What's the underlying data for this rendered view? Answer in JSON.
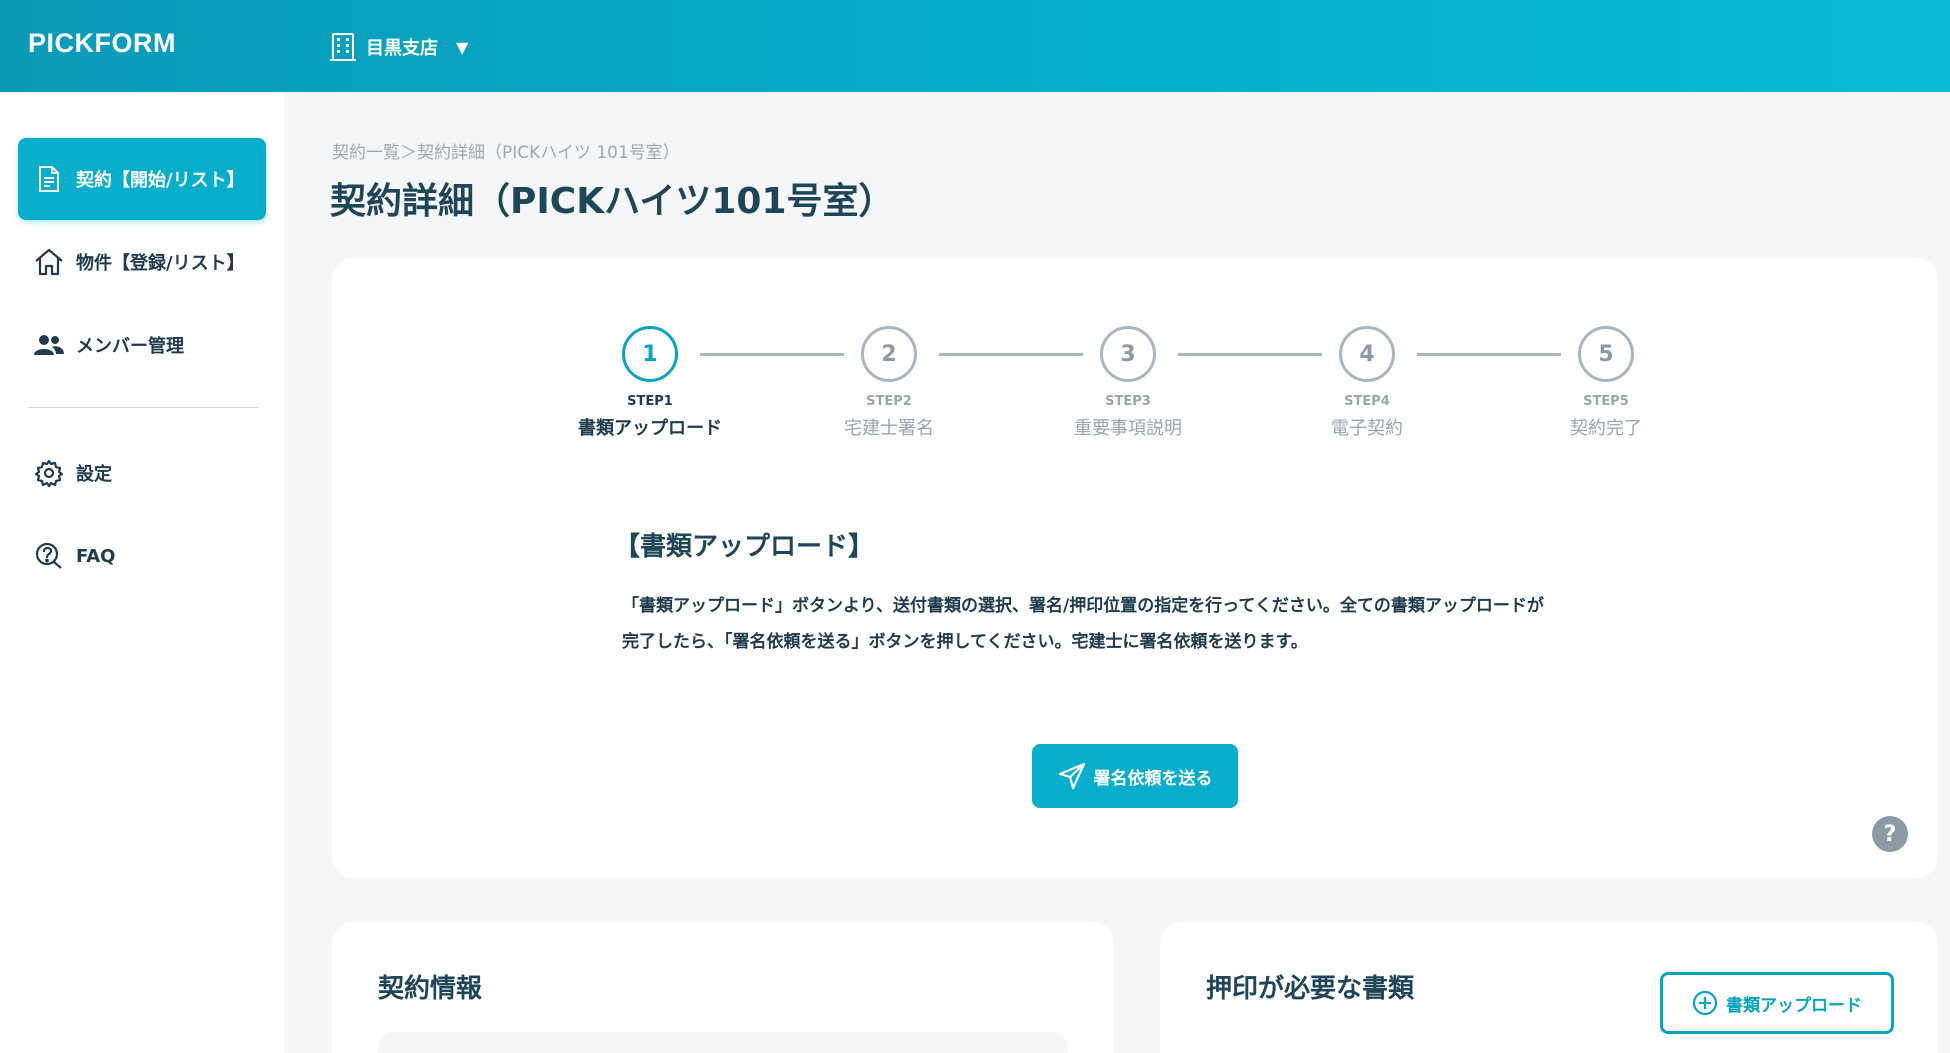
{
  "header": {
    "brand": "PICKFORM",
    "branch_label": "目黒支店",
    "branch_icon": "building-icon",
    "caret": "▼"
  },
  "sidebar": {
    "items": [
      {
        "label": "契約【開始/リスト】",
        "icon": "document-icon",
        "active": true
      },
      {
        "label": "物件【登録/リスト】",
        "icon": "home-icon",
        "active": false
      },
      {
        "label": "メンバー管理",
        "icon": "users-icon",
        "active": false
      },
      {
        "label": "設定",
        "icon": "gear-icon",
        "active": false
      },
      {
        "label": "FAQ",
        "icon": "question-chat-icon",
        "active": false
      }
    ]
  },
  "main": {
    "breadcrumb": "契約一覧＞契約詳細（PICKハイツ 101号室）",
    "title": "契約詳細（PICKハイツ101号室）",
    "steps": [
      {
        "number": "1",
        "code": "STEP1",
        "name": "書類アップロード",
        "active": true
      },
      {
        "number": "2",
        "code": "STEP2",
        "name": "宅建士署名",
        "active": false
      },
      {
        "number": "3",
        "code": "STEP3",
        "name": "重要事項説明",
        "active": false
      },
      {
        "number": "4",
        "code": "STEP4",
        "name": "電子契約",
        "active": false
      },
      {
        "number": "5",
        "code": "STEP5",
        "name": "契約完了",
        "active": false
      }
    ],
    "section_heading": "【書類アップロード】",
    "section_desc_line1": "「書類アップロード」ボタンより、送付書類の選択、署名/押印位置の指定を行ってください。全ての書類アップロードが",
    "section_desc_line2": "完了したら、「署名依頼を送る」ボタンを押してください。宅建士に署名依頼を送ります。",
    "send_button_label": "署名依頼を送る",
    "help_label": "?"
  },
  "contract_card": {
    "title": "契約情報"
  },
  "docs_card": {
    "title": "押印が必要な書類",
    "upload_button_label": "書類アップロード"
  },
  "colors": {
    "accent": "#06aecb",
    "header_start": "#0a9ab8",
    "header_end": "#0bbad3",
    "text_dark": "#1f4558",
    "muted": "#98a6b1"
  }
}
